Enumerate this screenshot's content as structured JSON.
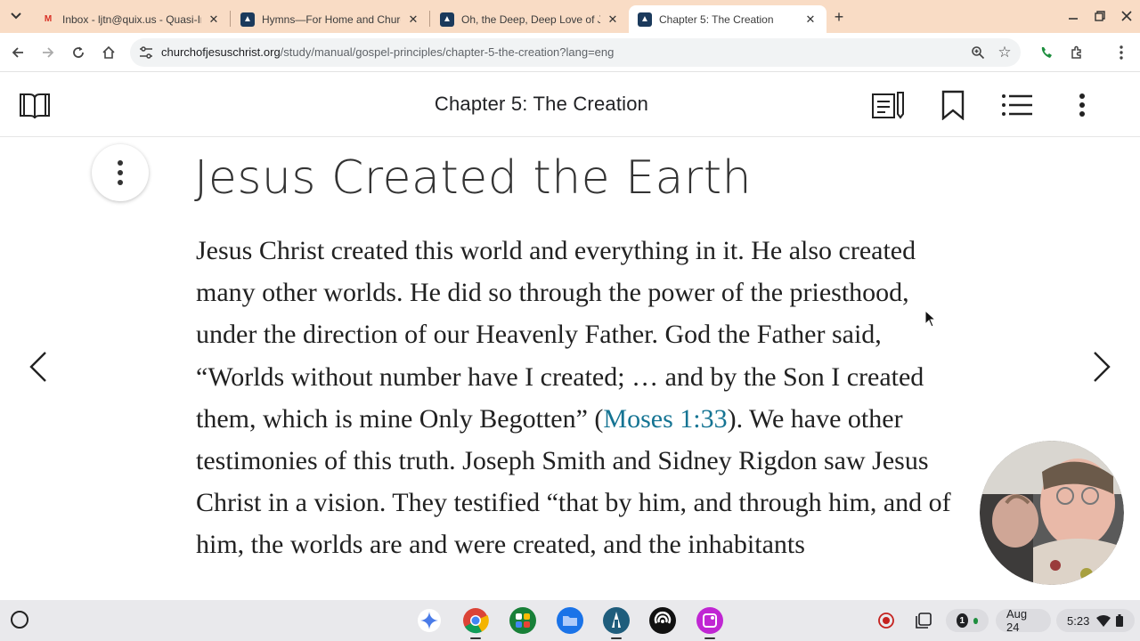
{
  "tabs": [
    {
      "title": "Inbox - ljtn@quix.us - Quasi-Ind",
      "icon": "gmail-icon",
      "active": false
    },
    {
      "title": "Hymns—For Home and Church",
      "icon": "church-logo-icon",
      "active": false
    },
    {
      "title": "Oh, the Deep, Deep Love of Jesu",
      "icon": "church-logo-icon",
      "active": false
    },
    {
      "title": "Chapter 5: The Creation",
      "icon": "church-logo-icon",
      "active": true
    }
  ],
  "omnibox": {
    "host": "churchofjesuschrist.org",
    "path": "/study/manual/gospel-principles/chapter-5-the-creation?lang=eng"
  },
  "page": {
    "header_title": "Chapter 5: The Creation",
    "heading": "Jesus Created the Earth",
    "paragraph_before_link": "Jesus Christ created this world and everything in it. He also created many other worlds. He did so through the power of the priesthood, under the direction of our Heavenly Father. God the Father said, “Worlds without number have I created; … and by the Son I created them, which is mine Only Begotten” (",
    "link_text": "Moses 1:33",
    "paragraph_after_link": "). We have other testimonies of this truth. Joseph Smith and Sidney Rigdon saw Jesus Christ in a vision. They testified “that by him, and through him, and of him, the worlds are and were created, and the inhabitants"
  },
  "shelf": {
    "apps": [
      "gemini-icon",
      "chrome-icon",
      "google-apps-icon",
      "files-icon",
      "gospel-library-icon",
      "podcast-icon",
      "screenshot-app-icon"
    ],
    "notification_count": "1",
    "date": "Aug 24",
    "time": "5:23"
  },
  "colors": {
    "tabstrip": "#f9dcc5",
    "link": "#157493",
    "shelf": "#e9e9ec"
  }
}
